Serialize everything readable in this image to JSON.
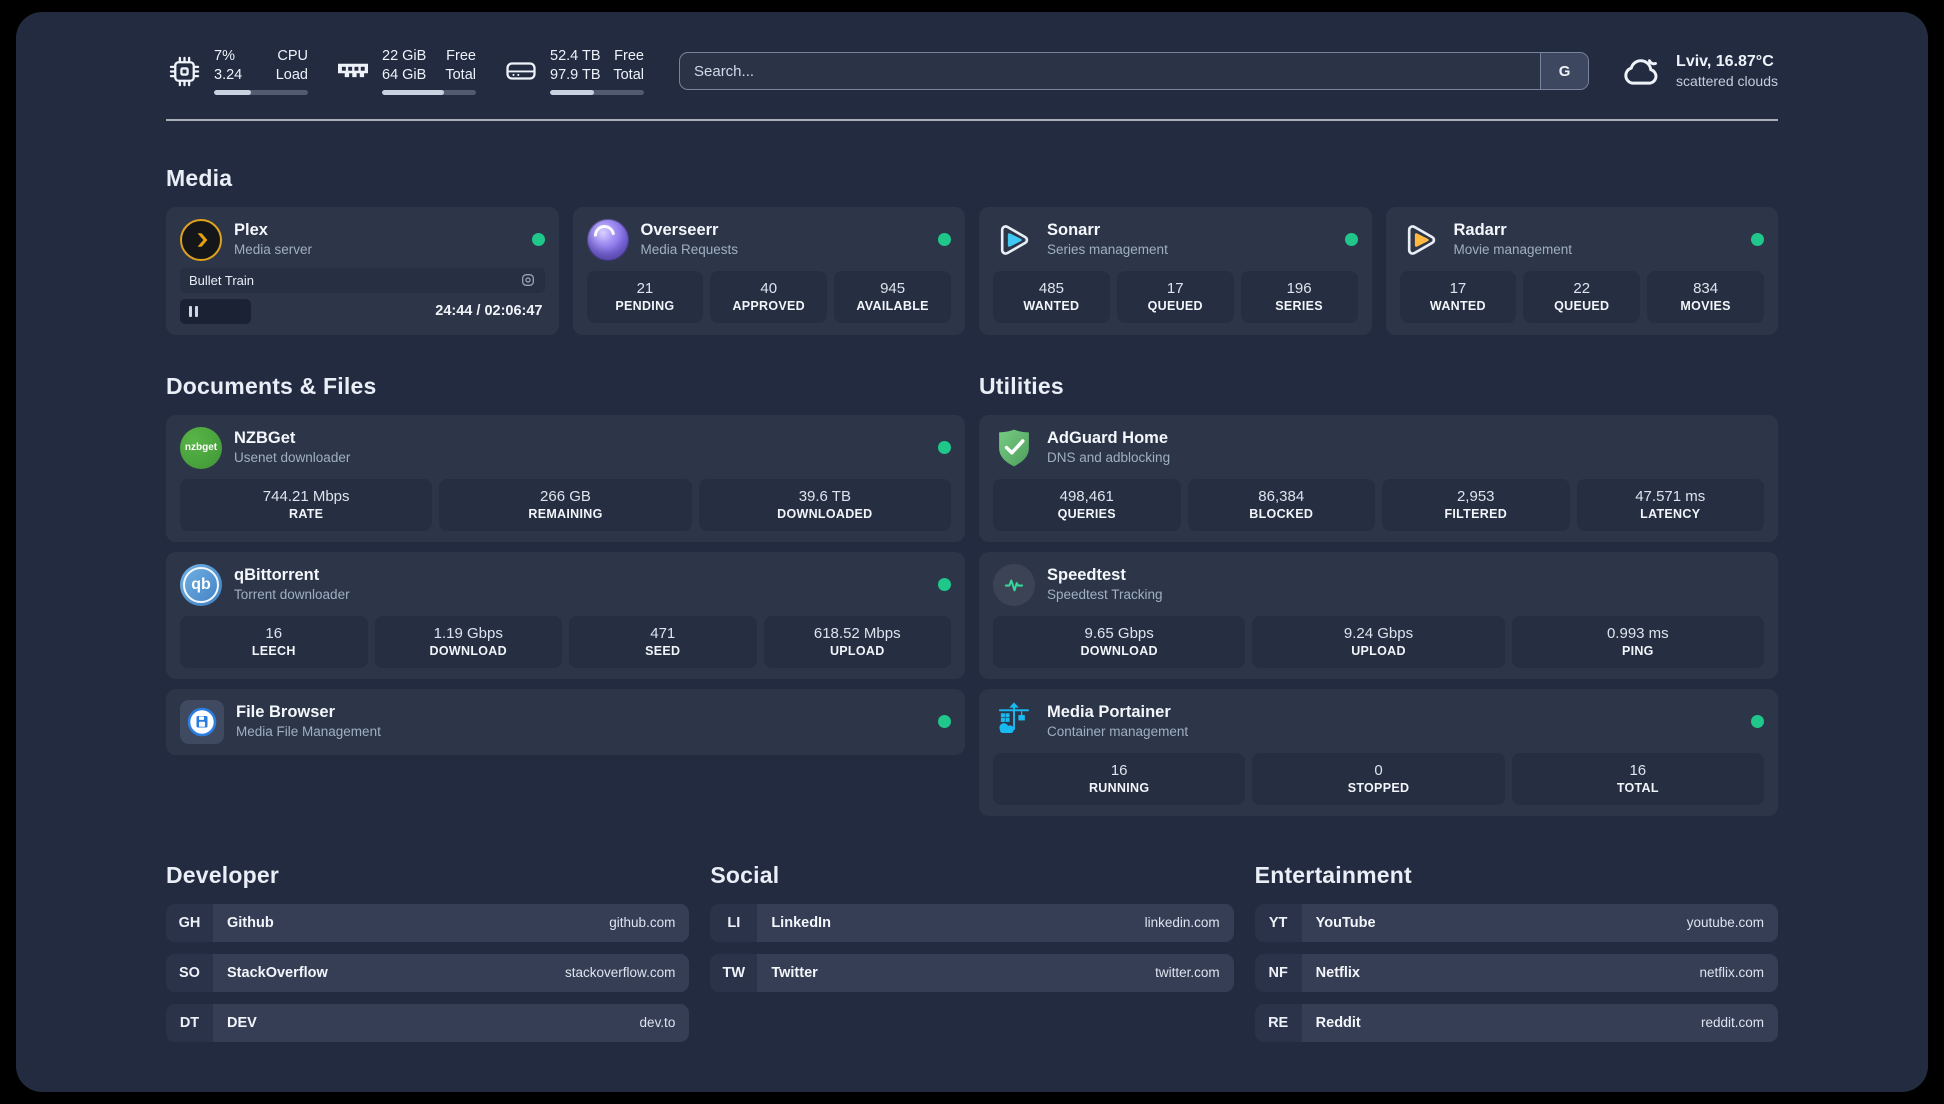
{
  "colors": {
    "status_online": "#1fc78b",
    "plex_amber": "#e5a00d",
    "sonarr_cyan": "#41c7f4",
    "radarr_amber": "#ffb93e",
    "nzbget_green": "#43a047",
    "qbittorrent_blue": "#4d8fd1",
    "adguard_green": "#5fae6b",
    "speedtest_green": "#37d69a",
    "portainer_blue": "#19b9f1"
  },
  "header": {
    "cpu": {
      "value1": "7%",
      "label1": "CPU",
      "value2": "3.24",
      "label2": "Load",
      "bar_percent": 39
    },
    "memory": {
      "value1": "22 GiB",
      "label1": "Free",
      "value2": "64 GiB",
      "label2": "Total",
      "bar_percent": 66
    },
    "disk": {
      "value1": "52.4 TB",
      "label1": "Free",
      "value2": "97.9 TB",
      "label2": "Total",
      "bar_percent": 47
    },
    "search": {
      "placeholder": "Search...",
      "engine_button": "G"
    },
    "weather": {
      "location": "Lviv, 16.87°C",
      "condition": "scattered clouds"
    }
  },
  "media": {
    "title": "Media",
    "plex": {
      "name": "Plex",
      "desc": "Media server",
      "now_playing": "Bullet Train",
      "time_display": "24:44 / 02:06:47",
      "progress_percent": 19.5
    },
    "overseerr": {
      "name": "Overseerr",
      "desc": "Media Requests",
      "stats": [
        {
          "value": "21",
          "label": "PENDING"
        },
        {
          "value": "40",
          "label": "APPROVED"
        },
        {
          "value": "945",
          "label": "AVAILABLE"
        }
      ]
    },
    "sonarr": {
      "name": "Sonarr",
      "desc": "Series management",
      "stats": [
        {
          "value": "485",
          "label": "WANTED"
        },
        {
          "value": "17",
          "label": "QUEUED"
        },
        {
          "value": "196",
          "label": "SERIES"
        }
      ]
    },
    "radarr": {
      "name": "Radarr",
      "desc": "Movie management",
      "stats": [
        {
          "value": "17",
          "label": "WANTED"
        },
        {
          "value": "22",
          "label": "QUEUED"
        },
        {
          "value": "834",
          "label": "MOVIES"
        }
      ]
    }
  },
  "documents": {
    "title": "Documents & Files",
    "nzbget": {
      "name": "NZBGet",
      "desc": "Usenet downloader",
      "icon_text": "nzbget",
      "stats": [
        {
          "value": "744.21 Mbps",
          "label": "RATE"
        },
        {
          "value": "266 GB",
          "label": "REMAINING"
        },
        {
          "value": "39.6 TB",
          "label": "DOWNLOADED"
        }
      ]
    },
    "qbittorrent": {
      "name": "qBittorrent",
      "desc": "Torrent downloader",
      "icon_text": "qb",
      "stats": [
        {
          "value": "16",
          "label": "LEECH"
        },
        {
          "value": "1.19 Gbps",
          "label": "DOWNLOAD"
        },
        {
          "value": "471",
          "label": "SEED"
        },
        {
          "value": "618.52 Mbps",
          "label": "UPLOAD"
        }
      ]
    },
    "filebrowser": {
      "name": "File Browser",
      "desc": "Media File Management"
    }
  },
  "utilities": {
    "title": "Utilities",
    "adguard": {
      "name": "AdGuard Home",
      "desc": "DNS and adblocking",
      "stats": [
        {
          "value": "498,461",
          "label": "QUERIES"
        },
        {
          "value": "86,384",
          "label": "BLOCKED"
        },
        {
          "value": "2,953",
          "label": "FILTERED"
        },
        {
          "value": "47.571 ms",
          "label": "LATENCY"
        }
      ]
    },
    "speedtest": {
      "name": "Speedtest",
      "desc": "Speedtest Tracking",
      "stats": [
        {
          "value": "9.65 Gbps",
          "label": "DOWNLOAD"
        },
        {
          "value": "9.24 Gbps",
          "label": "UPLOAD"
        },
        {
          "value": "0.993 ms",
          "label": "PING"
        }
      ]
    },
    "portainer": {
      "name": "Media Portainer",
      "desc": "Container management",
      "stats": [
        {
          "value": "16",
          "label": "RUNNING"
        },
        {
          "value": "0",
          "label": "STOPPED"
        },
        {
          "value": "16",
          "label": "TOTAL"
        }
      ]
    }
  },
  "links": {
    "developer": {
      "title": "Developer",
      "items": [
        {
          "abbr": "GH",
          "name": "Github",
          "url": "github.com"
        },
        {
          "abbr": "SO",
          "name": "StackOverflow",
          "url": "stackoverflow.com"
        },
        {
          "abbr": "DT",
          "name": "DEV",
          "url": "dev.to"
        }
      ]
    },
    "social": {
      "title": "Social",
      "items": [
        {
          "abbr": "LI",
          "name": "LinkedIn",
          "url": "linkedin.com"
        },
        {
          "abbr": "TW",
          "name": "Twitter",
          "url": "twitter.com"
        }
      ]
    },
    "entertainment": {
      "title": "Entertainment",
      "items": [
        {
          "abbr": "YT",
          "name": "YouTube",
          "url": "youtube.com"
        },
        {
          "abbr": "NF",
          "name": "Netflix",
          "url": "netflix.com"
        },
        {
          "abbr": "RE",
          "name": "Reddit",
          "url": "reddit.com"
        }
      ]
    }
  }
}
